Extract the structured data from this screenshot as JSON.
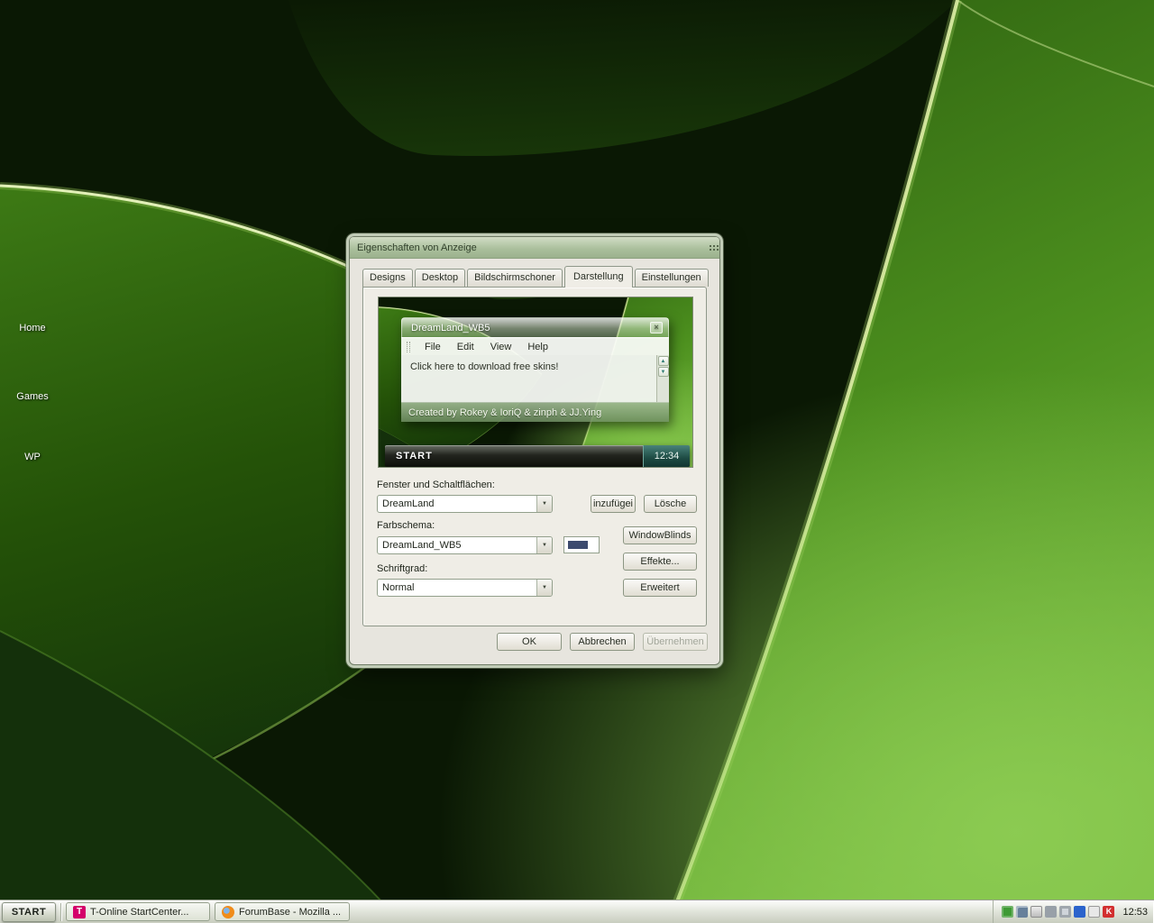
{
  "icons": {
    "dropdown_arrow": "▼",
    "scroll_up": "▲",
    "scroll_down": "▼",
    "close": "×",
    "t_online_glyph": "T",
    "antivirus_glyph": "K"
  },
  "desktop": {
    "icons": [
      {
        "label": "Home"
      },
      {
        "label": "Games"
      },
      {
        "label": "WP"
      }
    ]
  },
  "dialog": {
    "title": "Eigenschaften von Anzeige",
    "tabs": [
      "Designs",
      "Desktop",
      "Bildschirmschoner",
      "Darstellung",
      "Einstellungen"
    ],
    "active_tab": "Darstellung",
    "preview": {
      "window_title": "DreamLand_WB5",
      "menu_items": [
        "File",
        "Edit",
        "View",
        "Help"
      ],
      "body_text": "Click here to download free skins!",
      "status_text": "Created by Rokey & IoriQ & zinph & JJ.Ying",
      "taskbar_label": "START",
      "clock": "12:34"
    },
    "form": {
      "windows_label": "Fenster und Schaltflächen:",
      "windows_value": "DreamLand",
      "add_button": "inzufügei",
      "delete_button": "Lösche",
      "scheme_label": "Farbschema:",
      "scheme_value": "DreamLand_WB5",
      "windowblinds_button": "WindowBlinds",
      "effects_button": "Effekte...",
      "fontsize_label": "Schriftgrad:",
      "fontsize_value": "Normal",
      "advanced_button": "Erweitert"
    },
    "actions": {
      "ok": "OK",
      "cancel": "Abbrechen",
      "apply": "Übernehmen"
    }
  },
  "taskbar": {
    "start_label": "START",
    "tasks": [
      {
        "label": "T-Online StartCenter..."
      },
      {
        "label": "ForumBase - Mozilla ..."
      }
    ],
    "tray_icons": [
      "plant-utility",
      "display-settings",
      "window-manager",
      "removable-device",
      "volume",
      "messenger",
      "print-spooler",
      "antivirus"
    ],
    "clock": "12:53"
  },
  "colors": {
    "dialog_face": "#e7e5de",
    "accent_teal": "#2f7a72",
    "leaf_green": "#5ea32a",
    "color_sample": "#3c4a6e"
  }
}
